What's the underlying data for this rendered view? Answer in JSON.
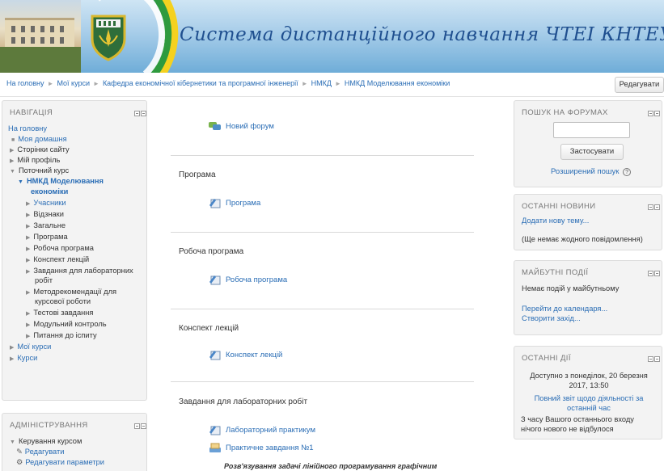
{
  "header": {
    "title": "Система дистанційного навчання ЧТЕІ КНТЕУ"
  },
  "breadcrumb": [
    "На головну",
    "Мої курси",
    "Кафедра економічної кібернетики та програмної інженерії",
    "НМКД",
    "НМКД Моделювання економіки"
  ],
  "edit_button": "Редагувати",
  "navigation": {
    "title": "НАВІГАЦІЯ",
    "items": [
      {
        "label": "На головну"
      },
      {
        "label": "Моя домашня"
      },
      {
        "label": "Сторінки сайту"
      },
      {
        "label": "Мій профіль"
      },
      {
        "label": "Поточний курс"
      },
      {
        "label": "НМКД Моделювання"
      },
      {
        "label": "економіки"
      },
      {
        "label": "Учасники"
      },
      {
        "label": "Відзнаки"
      },
      {
        "label": "Загальне"
      },
      {
        "label": "Програма"
      },
      {
        "label": "Робоча програма"
      },
      {
        "label": "Конспект лекцій"
      },
      {
        "label": "Завдання для лабораторних"
      },
      {
        "label": "робіт"
      },
      {
        "label": "Методрекомендації для"
      },
      {
        "label": "курсової роботи"
      },
      {
        "label": "Тестові завдання"
      },
      {
        "label": "Модульний контроль"
      },
      {
        "label": "Питання до іспиту"
      },
      {
        "label": "Мої курси"
      },
      {
        "label": "Курси"
      }
    ]
  },
  "admin": {
    "title": "АДМІНІСТРУВАННЯ",
    "items": [
      {
        "label": "Керування курсом"
      },
      {
        "label": "Редагувати"
      },
      {
        "label": "Редагувати параметри"
      }
    ]
  },
  "main": {
    "forum": "Новий форум",
    "sections": [
      {
        "title": "Програма",
        "activities": [
          "Програма"
        ]
      },
      {
        "title": "Робоча програма",
        "activities": [
          "Робоча програма"
        ]
      },
      {
        "title": "Конспект лекцій",
        "activities": [
          "Конспект лекцій"
        ]
      },
      {
        "title": "Завдання для лабораторних робіт",
        "activities": [
          "Лабораторний практикум",
          "Практичне завдання №1"
        ]
      }
    ],
    "bottom_note": "Розв'язування задачі лінійного програмування графічним"
  },
  "forum_search": {
    "title": "ПОШУК НА ФОРУМАХ",
    "search_value": "",
    "apply_button": "Застосувати",
    "advanced": "Розширений пошук",
    "help_icon": "?"
  },
  "news": {
    "title": "ОСТАННІ НОВИНИ",
    "add_topic": "Додати нову тему...",
    "empty": "(Ще немає жодного повідомлення)"
  },
  "upcoming": {
    "title": "МАЙБУТНІ ПОДІЇ",
    "none": "Немає подій у майбутньому",
    "calendar": "Перейти до календаря...",
    "create": "Створити захід..."
  },
  "recent": {
    "title": "ОСТАННІ ДІЇ",
    "since": "Доступно з понеділок, 20 березня 2017, 13:50",
    "full_report": "Повний звіт щодо діяльності за останній час",
    "nothing": "З часу Вашого останнього входу нічого нового не відбулося"
  },
  "colors": {
    "link": "#2a6db5",
    "header_blue": "#6fadd8",
    "block_bg": "#f3f3f3",
    "title_color": "#1f4f8f"
  },
  "icons": {
    "forum": "forum-icon",
    "page": "page-icon",
    "assignment": "assignment-icon"
  }
}
